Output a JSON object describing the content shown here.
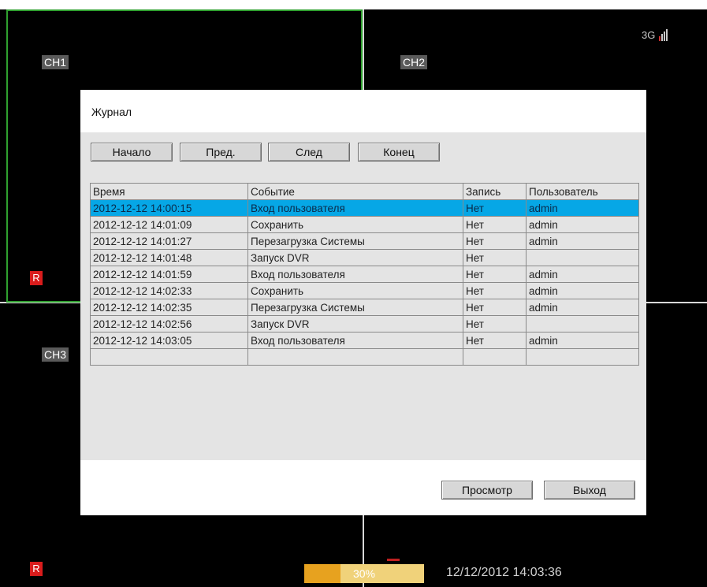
{
  "channels": {
    "ch1": "CH1",
    "ch2": "CH2",
    "ch3": "CH3"
  },
  "rec_indicator": "R",
  "network": {
    "label": "3G",
    "signal_bars": 4,
    "signal_color": "#c8c8c8",
    "signal_low_color": "#d23030"
  },
  "dialog": {
    "title": "Журнал",
    "nav": {
      "first": "Начало",
      "prev": "Пред.",
      "next": "След",
      "last": "Конец"
    },
    "table": {
      "headers": [
        "Время",
        "Событие",
        "Запись",
        "Пользователь"
      ],
      "rows": [
        [
          "2012-12-12 14:00:15",
          "Вход пользователя",
          "Нет",
          "admin"
        ],
        [
          "2012-12-12 14:01:09",
          "Сохранить",
          "Нет",
          "admin"
        ],
        [
          "2012-12-12 14:01:27",
          "Перезагрузка Системы",
          "Нет",
          "admin"
        ],
        [
          "2012-12-12 14:01:48",
          "Запуск DVR",
          "Нет",
          ""
        ],
        [
          "2012-12-12 14:01:59",
          "Вход пользователя",
          "Нет",
          "admin"
        ],
        [
          "2012-12-12 14:02:33",
          "Сохранить",
          "Нет",
          "admin"
        ],
        [
          "2012-12-12 14:02:35",
          "Перезагрузка Системы",
          "Нет",
          "admin"
        ],
        [
          "2012-12-12 14:02:56",
          "Запуск DVR",
          "Нет",
          ""
        ],
        [
          "2012-12-12 14:03:05",
          "Вход пользователя",
          "Нет",
          "admin"
        ],
        [
          "",
          "",
          "",
          ""
        ]
      ],
      "selected_row": 0
    },
    "view_label": "Просмотр",
    "exit_label": "Выход"
  },
  "status": {
    "progress_percent": 30,
    "progress_label": "30%",
    "datetime": "12/12/2012 14:03:36"
  },
  "colors": {
    "selection": "#06a7e6",
    "active_channel_border": "#2fa02f",
    "progress_fill": "#e7a21f",
    "progress_track": "#f0d27a",
    "record": "#d91c1c"
  }
}
